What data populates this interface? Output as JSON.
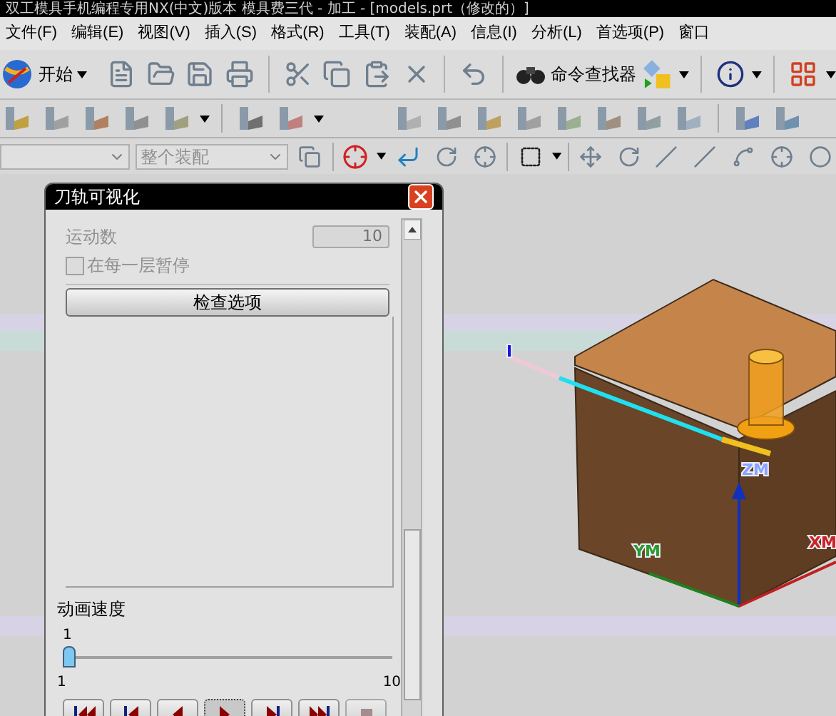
{
  "title_bar": {
    "title": "双工模具手机编程专用NX(中文)版本 模具费三代 - 加工 - [models.prt（修改的）]"
  },
  "menu": [
    {
      "label": "文件(F)"
    },
    {
      "label": "编辑(E)"
    },
    {
      "label": "视图(V)"
    },
    {
      "label": "插入(S)"
    },
    {
      "label": "格式(R)"
    },
    {
      "label": "工具(T)"
    },
    {
      "label": "装配(A)"
    },
    {
      "label": "信息(I)"
    },
    {
      "label": "分析(L)"
    },
    {
      "label": "首选项(P)"
    },
    {
      "label": "窗口"
    }
  ],
  "toolbar": {
    "start_label": "开始",
    "command_finder_label": "命令查找器"
  },
  "selection_bar": {
    "assembly_filter": {
      "value": "整个装配",
      "disabled": true
    }
  },
  "dialog": {
    "title": "刀轨可视化",
    "motion_count": {
      "label": "运动数",
      "value": "10",
      "disabled": true
    },
    "pause_each_layer": {
      "label": "在每一层暂停",
      "checked": false,
      "disabled": true
    },
    "check_button": "检查选项",
    "speed": {
      "label": "动画速度",
      "reading": "1",
      "level": 0,
      "min": "1",
      "max": "10"
    },
    "playback": [
      {
        "kind": "first",
        "selected": false,
        "disabled": false
      },
      {
        "kind": "prev",
        "selected": false,
        "disabled": false
      },
      {
        "kind": "reverse",
        "selected": false,
        "disabled": false
      },
      {
        "kind": "play",
        "selected": true,
        "disabled": false
      },
      {
        "kind": "next",
        "selected": false,
        "disabled": false
      },
      {
        "kind": "last",
        "selected": false,
        "disabled": false
      },
      {
        "kind": "stop",
        "selected": false,
        "disabled": true
      }
    ]
  },
  "viewport": {
    "labels": [
      {
        "kind": "tool_axis",
        "text": "I",
        "color": "#1a1ad0"
      },
      {
        "kind": "zm",
        "text": "ZM",
        "color": "#8aa4ff"
      },
      {
        "kind": "ym",
        "text": "YM",
        "color": "#2a9a2a"
      },
      {
        "kind": "xm",
        "text": "XM",
        "color": "#d02020"
      }
    ]
  }
}
